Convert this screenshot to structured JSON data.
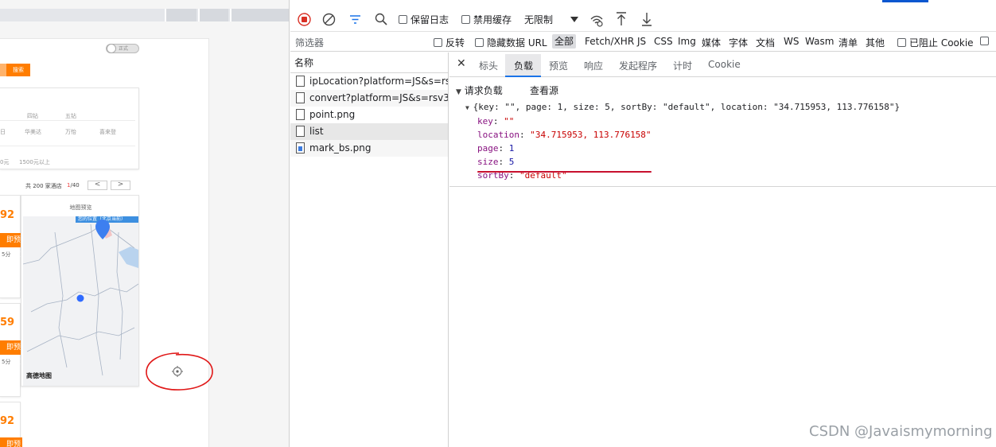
{
  "page": {
    "toggle_label": "正式",
    "search_button": "搜索",
    "filter_labels": [
      "四钻",
      "五钻"
    ],
    "brand_labels": [
      "日",
      "华美达",
      "万怡",
      "喜来登"
    ],
    "price_labels": [
      "0元",
      "1500元以上"
    ],
    "pager_total": "共 200 家酒店",
    "pager_current": "1",
    "pager_total_pages": "/40",
    "pager_prev": "<",
    "pager_next": ">",
    "hotel_cards": [
      {
        "price": "92",
        "book_label": "即预定",
        "score": "5分"
      },
      {
        "price": "59",
        "book_label": "即预定",
        "score": "5分"
      },
      {
        "price": "92",
        "book_label": "即预定",
        "score": ""
      }
    ],
    "map_title": "地图预览",
    "map_tag": "您的位置（北京当前）",
    "map_logo": "高德地图"
  },
  "devtools": {
    "toolbar": {
      "preserve_log": "保留日志",
      "disable_cache": "禁用缓存",
      "throttle": "无限制"
    },
    "filter_bar": {
      "placeholder": "筛选器",
      "invert": "反转",
      "hide_data_url": "隐藏数据 URL",
      "all": "全部",
      "types": [
        "Fetch/XHR",
        "JS",
        "CSS",
        "Img",
        "媒体",
        "字体",
        "文档",
        "WS",
        "Wasm",
        "清单",
        "其他"
      ],
      "blocked_cookie": "已阻止 Cookie"
    },
    "request_list": {
      "header": "名称",
      "items": [
        {
          "name": "ipLocation?platform=JS&s=rs..."
        },
        {
          "name": "convert?platform=JS&s=rsv3..."
        },
        {
          "name": "point.png"
        },
        {
          "name": "list"
        },
        {
          "name": "mark_bs.png"
        }
      ]
    },
    "detail_tabs": [
      "标头",
      "负载",
      "预览",
      "响应",
      "发起程序",
      "计时",
      "Cookie"
    ],
    "payload": {
      "section_title": "请求负载",
      "view_source": "查看源",
      "summary": "{key: \"\", page: 1, size: 5, sortBy: \"default\", location: \"34.715953, 113.776158\"}",
      "fields": [
        {
          "key": "key",
          "value": "\"\""
        },
        {
          "key": "location",
          "value": "\"34.715953, 113.776158\""
        },
        {
          "key": "page",
          "value": "1"
        },
        {
          "key": "size",
          "value": "5"
        },
        {
          "key": "sortBy",
          "value": "\"default\""
        }
      ]
    }
  },
  "watermark": "CSDN @Javaismymorning",
  "colors": {
    "accent_orange": "#ff7d00",
    "devtools_blue": "#1a73e8",
    "annotation_red": "#c8102e"
  }
}
